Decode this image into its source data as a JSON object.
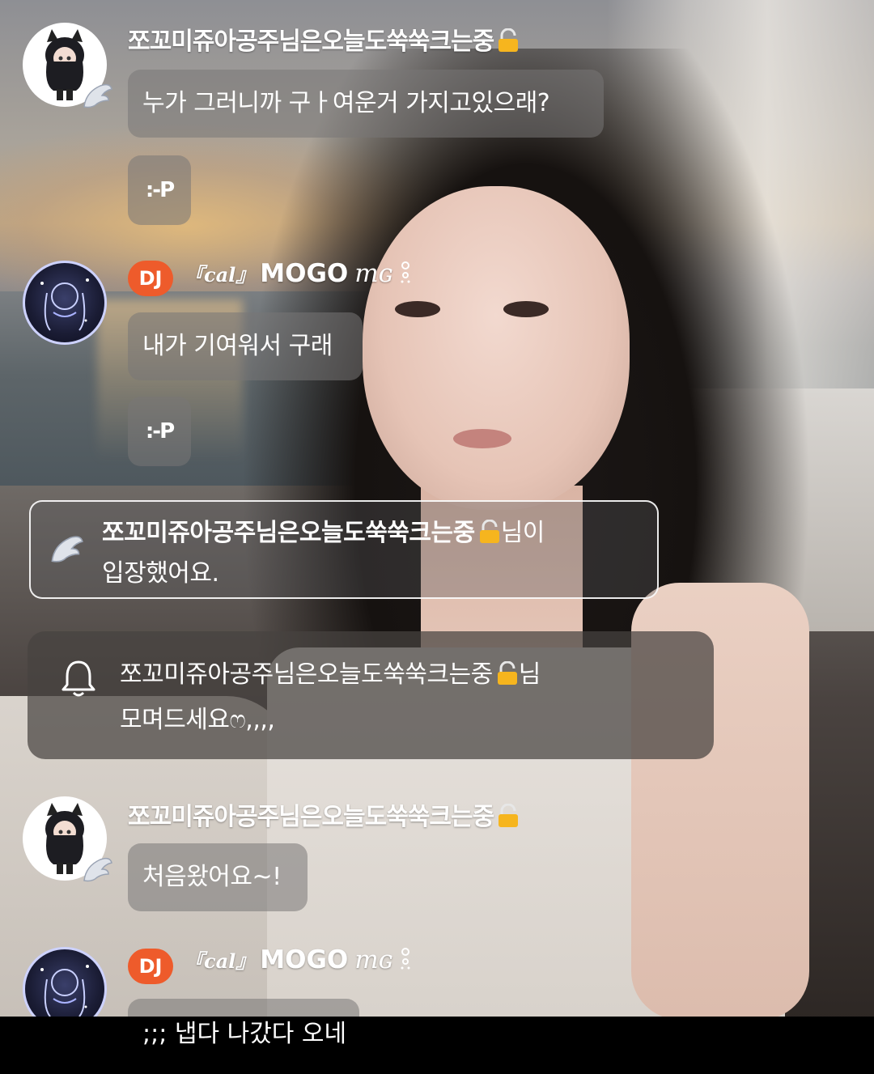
{
  "messages": [
    {
      "user": "쪼꼬미쥬아공주님은오늘도쑥쑥크는중",
      "role": "listener",
      "text": "누가 그러니까 구ㅏ여운거 가지고있으래?",
      "sticker": ":-P"
    },
    {
      "user": "MOGO",
      "badge": "DJ",
      "tag": "『cal』",
      "suffix": "mɢ",
      "text": "내가 기여워서 구래",
      "sticker": ":-P"
    },
    {
      "user": "쪼꼬미쥬아공주님은오늘도쑥쑥크는중",
      "role": "listener",
      "text": "처음왔어요~!"
    },
    {
      "user": "MOGO",
      "badge": "DJ",
      "tag": "『cal』",
      "suffix": "mɢ",
      "text": ";;; 냅다 나갔다 오네"
    }
  ],
  "entry_notice": {
    "user": "쪼꼬미쥬아공주님은오늘도쑥쑥크는중",
    "suffix_line1": "님이",
    "line2": "입장했어요."
  },
  "dj_notice": {
    "line1_user": "쪼꼬미쥬아공주님은오늘도쑥쑥크는중",
    "line1_suffix": "님",
    "line2": "모며드세요ෆ,,,,"
  },
  "icons": {
    "lock": "lock-icon",
    "wing": "wing-badge-icon",
    "bell": "bell-icon",
    "sparkle": "sparkle-icon"
  },
  "colors": {
    "dj_badge": "#ee5b2b",
    "bubble": "rgba(120,118,118,0.55)",
    "lock": "#f6b51e"
  }
}
